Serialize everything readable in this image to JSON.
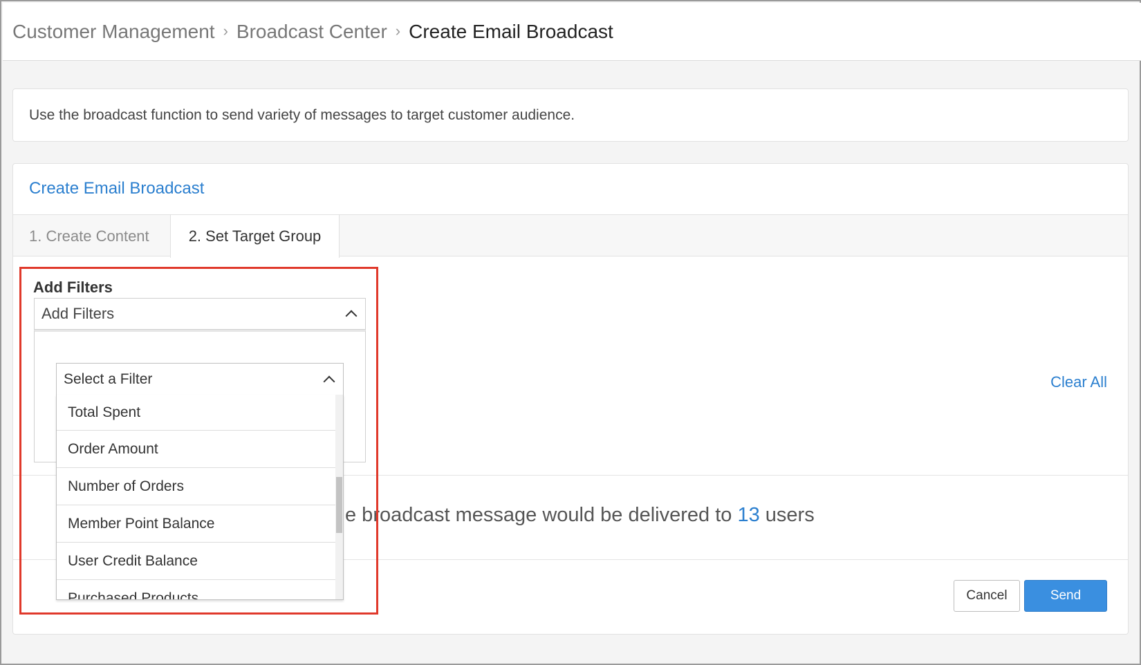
{
  "breadcrumb": {
    "items": [
      "Customer Management",
      "Broadcast Center",
      "Create Email Broadcast"
    ],
    "separator": ">"
  },
  "info": {
    "text": "Use the broadcast function to send variety of messages to target customer audience."
  },
  "card": {
    "title": "Create Email Broadcast",
    "tabs": [
      {
        "label": "1. Create Content",
        "active": false
      },
      {
        "label": "2. Set Target Group",
        "active": true
      }
    ]
  },
  "filters": {
    "label": "Add Filters",
    "select_value": "Add Filters",
    "filter_select_placeholder": "Select a Filter",
    "options": [
      "Total Spent",
      "Order Amount",
      "Number of Orders",
      "Member Point Balance",
      "User Credit Balance",
      "Purchased Products"
    ],
    "scroll_position": 0.55
  },
  "clear_all_label": "Clear All",
  "delivery": {
    "prefix": "e broadcast message would be delivered to",
    "count": "13",
    "suffix": "users"
  },
  "actions": {
    "cancel_label": "Cancel",
    "send_label": "Send"
  },
  "colors": {
    "accent": "#2b7fcf",
    "send_button": "#3a8fe0",
    "highlight": "#e0392b"
  },
  "icons": {
    "crumb_separator": "chevron-right-icon",
    "select_toggle": "chevron-up-icon"
  }
}
